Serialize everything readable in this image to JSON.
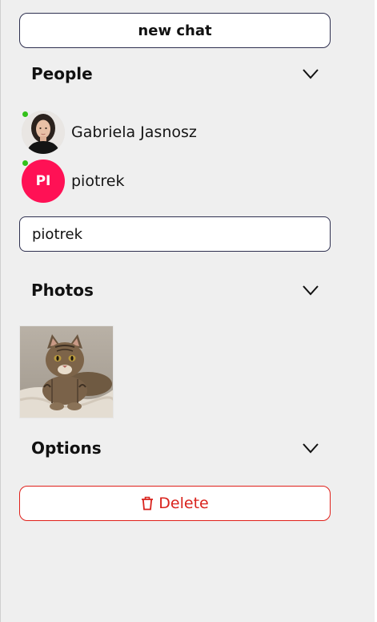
{
  "actions": {
    "new_chat_label": "new chat",
    "delete_label": "Delete"
  },
  "sections": {
    "people_title": "People",
    "photos_title": "Photos",
    "options_title": "Options"
  },
  "people": [
    {
      "name": "Gabriela Jasnosz",
      "initials": "",
      "online": true,
      "avatar": "photo"
    },
    {
      "name": "piotrek",
      "initials": "PI",
      "online": true,
      "avatar": "initials"
    }
  ],
  "search": {
    "value": "piotrek",
    "placeholder": ""
  },
  "photos": [
    {
      "icon": "cat-photo"
    }
  ],
  "colors": {
    "online": "#33c11a",
    "avatar_bg": "#ff1155",
    "danger": "#d9231d",
    "border": "#2e3050"
  }
}
